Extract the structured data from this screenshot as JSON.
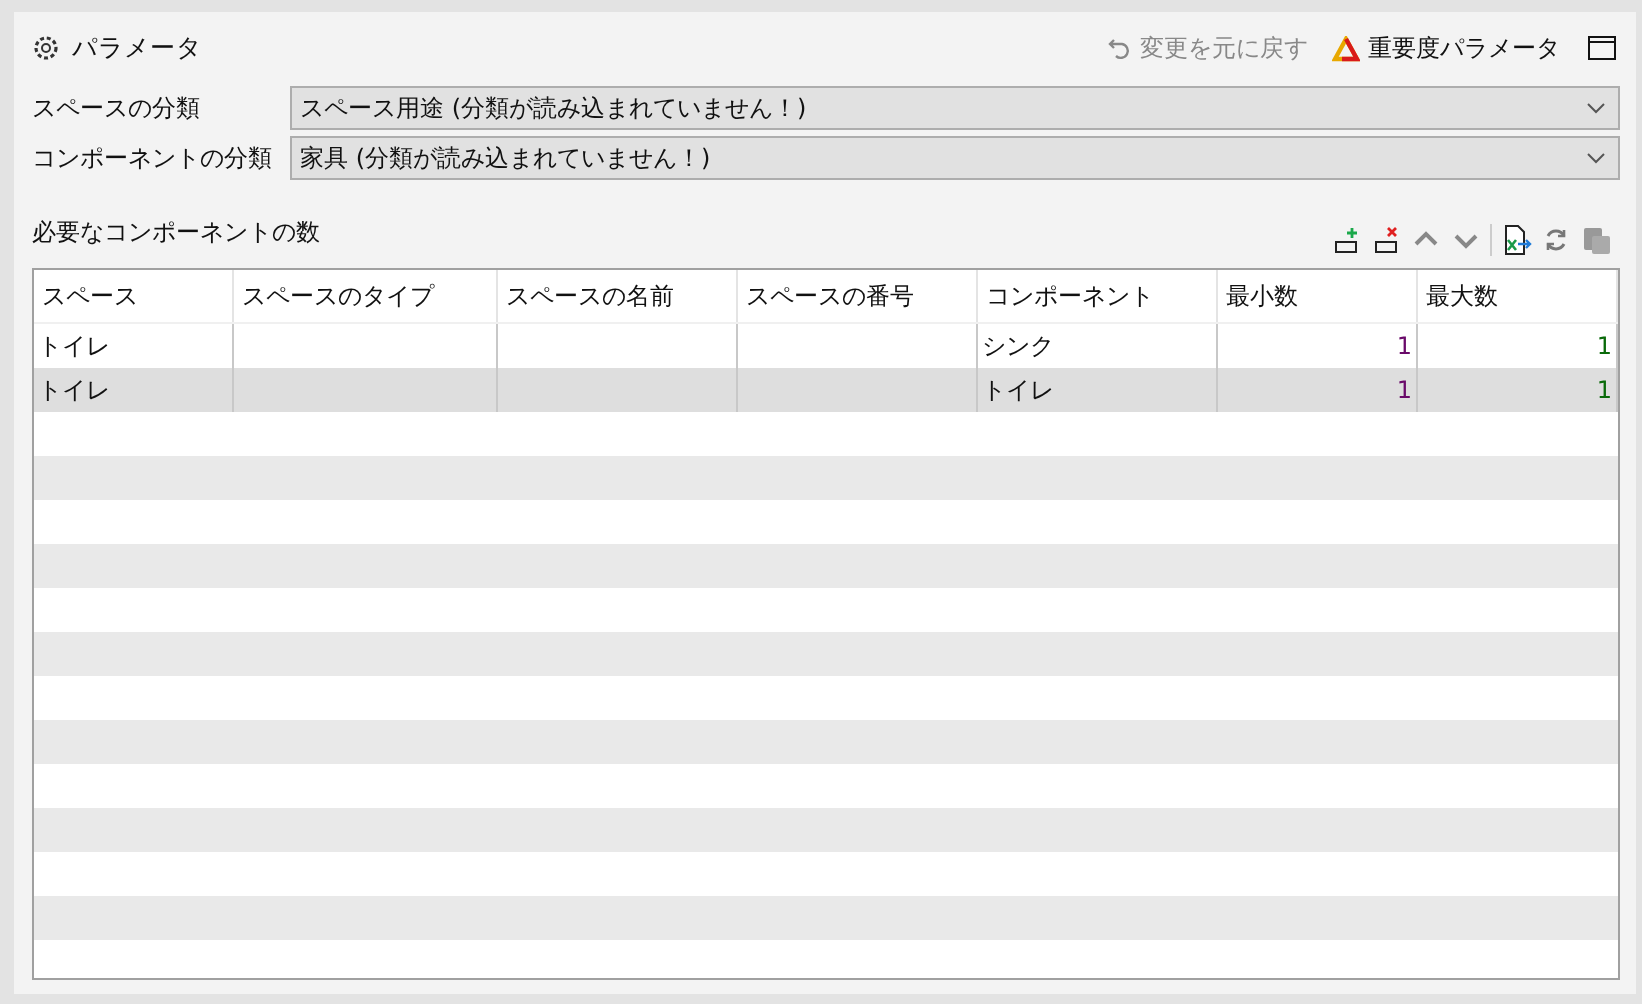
{
  "panel": {
    "title": "パラメータ",
    "undo": "変更を元に戻す",
    "critical": "重要度パラメータ"
  },
  "fields": [
    {
      "label": "スペースの分類",
      "value": "スペース用途 (分類が読み込まれていません！)"
    },
    {
      "label": "コンポーネントの分類",
      "value": "家具 (分類が読み込まれていません！)"
    }
  ],
  "section": {
    "title": "必要なコンポーネントの数"
  },
  "table": {
    "columns": [
      "スペース",
      "スペースのタイプ",
      "スペースの名前",
      "スペースの番号",
      "コンポーネント",
      "最小数",
      "最大数"
    ],
    "rows": [
      [
        "トイレ",
        "",
        "",
        "",
        "シンク",
        "1",
        "1"
      ],
      [
        "トイレ",
        "",
        "",
        "",
        "トイレ",
        "1",
        "1"
      ]
    ]
  }
}
